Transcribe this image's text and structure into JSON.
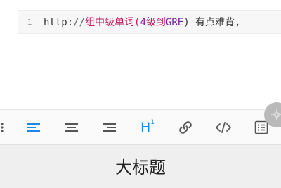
{
  "editor": {
    "line_number": "1",
    "code_parts": {
      "proto": "http",
      "colon": ":",
      "slashes": "//",
      "cn1": "组中级单词",
      "paren_open": "(",
      "num": "4",
      "cn2": "级到",
      "gre": "GRE",
      "rest": ") 有点难背,"
    }
  },
  "toolbar": {
    "items": [
      {
        "name": "overflow-left",
        "icon": "dots-vertical-icon"
      },
      {
        "name": "align-left",
        "icon": "align-left-icon",
        "active": true
      },
      {
        "name": "align-center",
        "icon": "align-center-icon"
      },
      {
        "name": "align-right",
        "icon": "align-right-icon"
      },
      {
        "name": "heading",
        "icon": "heading-icon",
        "label": "H",
        "sup": "1"
      },
      {
        "name": "link",
        "icon": "link-icon"
      },
      {
        "name": "code",
        "icon": "code-icon"
      },
      {
        "name": "list",
        "icon": "list-box-icon"
      }
    ],
    "active_color": "#1e88e5",
    "icon_color": "#555555"
  },
  "floating_button": {
    "icon": "settings-icon"
  },
  "heading_bar": {
    "label": "大标题"
  }
}
